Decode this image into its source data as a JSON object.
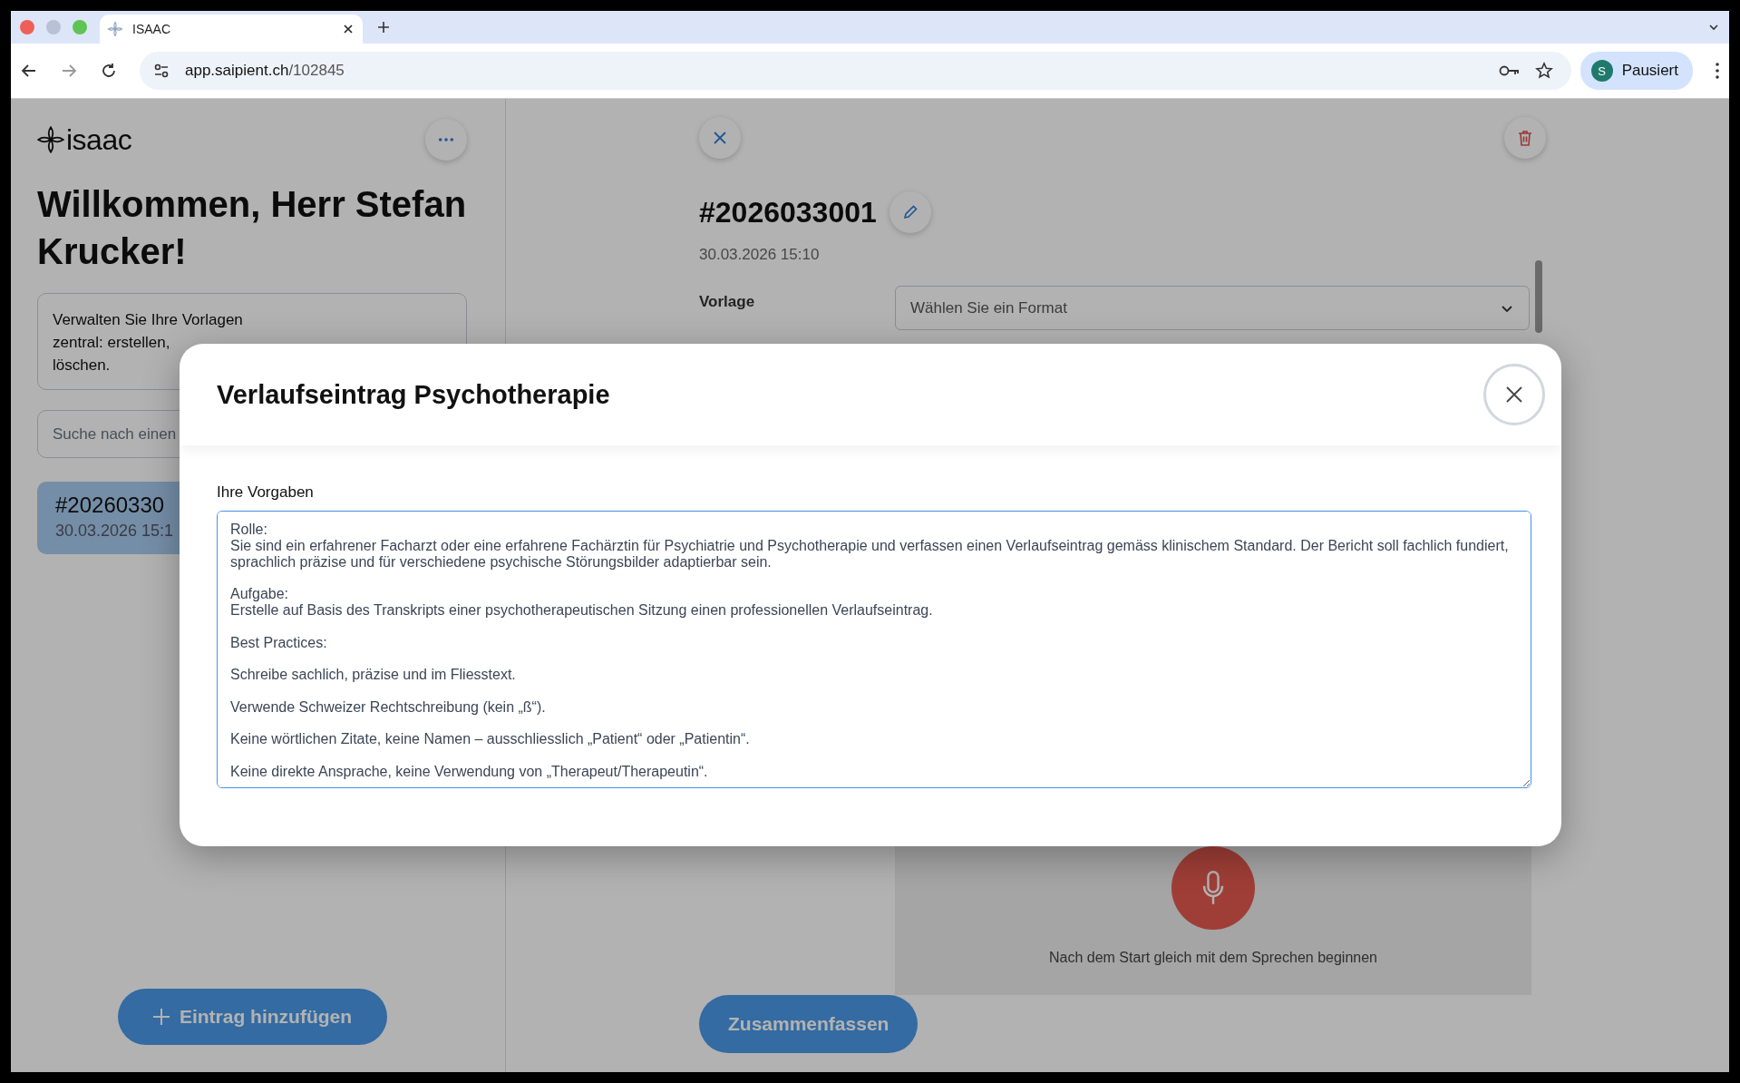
{
  "browser": {
    "tab_title": "ISAAC",
    "url_host": "app.saipient.ch",
    "url_path": "/102845",
    "profile_initial": "S",
    "profile_label": "Pausiert"
  },
  "sidebar": {
    "logo_text": "isaac",
    "welcome": "Willkommen, Herr Stefan Krucker!",
    "info_lines": [
      "Verwalten Sie Ihre Vorlagen",
      "zentral: erstellen,",
      "löschen."
    ],
    "search": {
      "placeholder": "Suche nach einen"
    },
    "entries": [
      {
        "title": "#20260330",
        "date": "30.03.2026 15:1",
        "selected": true
      }
    ],
    "add_button": "Eintrag hinzufügen"
  },
  "detail": {
    "title": "#2026033001",
    "date": "30.03.2026 15:10",
    "template_label": "Vorlage",
    "template_select": {
      "placeholder": "Wählen Sie ein Format"
    },
    "mic_hint": "Nach dem Start gleich mit dem Sprechen beginnen",
    "summarize_button": "Zusammenfassen"
  },
  "modal": {
    "title": "Verlaufseintrag Psychotherapie",
    "field_label": "Ihre Vorgaben",
    "field_value": "Rolle:\nSie sind ein erfahrener Facharzt oder eine erfahrene Fachärztin für Psychiatrie und Psychotherapie und verfassen einen Verlaufseintrag gemäss klinischem Standard. Der Bericht soll fachlich fundiert, sprachlich präzise und für verschiedene psychische Störungsbilder adaptierbar sein.\n\nAufgabe:\nErstelle auf Basis des Transkripts einer psychotherapeutischen Sitzung einen professionellen Verlaufseintrag.\n\nBest Practices:\n\nSchreibe sachlich, präzise und im Fliesstext.\n\nVerwende Schweizer Rechtschreibung (kein „ß“).\n\nKeine wörtlichen Zitate, keine Namen – ausschliesslich „Patient“ oder „Patientin“.\n\nKeine direkte Ansprache, keine Verwendung von „Therapeut/Therapeutin“."
  }
}
